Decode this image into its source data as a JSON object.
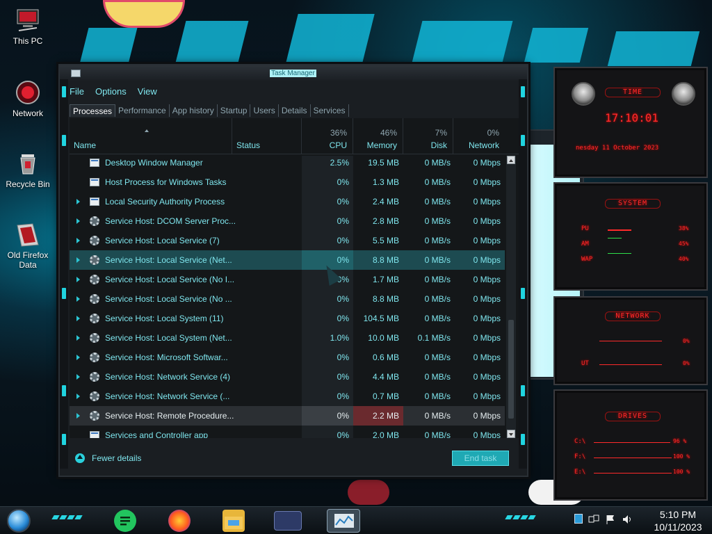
{
  "desktop": {
    "icons": [
      {
        "label": "This PC"
      },
      {
        "label": "Network"
      },
      {
        "label": "Recycle Bin"
      },
      {
        "label": "Old Firefox Data"
      }
    ]
  },
  "task_manager": {
    "title": "Task Manager",
    "menu": [
      "File",
      "Options",
      "View"
    ],
    "tabs": [
      "Processes",
      "Performance",
      "App history",
      "Startup",
      "Users",
      "Details",
      "Services"
    ],
    "active_tab": "Processes",
    "columns": {
      "name": {
        "label": "Name"
      },
      "status": {
        "label": "Status"
      },
      "cpu": {
        "label": "CPU",
        "pct": "36%"
      },
      "memory": {
        "label": "Memory",
        "pct": "46%"
      },
      "disk": {
        "label": "Disk",
        "pct": "7%"
      },
      "network": {
        "label": "Network",
        "pct": "0%"
      }
    },
    "processes": [
      {
        "name": "Desktop Window Manager",
        "cpu": "2.5%",
        "memory": "19.5 MB",
        "disk": "0 MB/s",
        "network": "0 Mbps",
        "icon": "window-icon",
        "expandable": false
      },
      {
        "name": "Host Process for Windows Tasks",
        "cpu": "0%",
        "memory": "1.3 MB",
        "disk": "0 MB/s",
        "network": "0 Mbps",
        "icon": "window-icon",
        "expandable": false
      },
      {
        "name": "Local Security Authority Process",
        "cpu": "0%",
        "memory": "2.4 MB",
        "disk": "0 MB/s",
        "network": "0 Mbps",
        "icon": "window-icon",
        "expandable": true
      },
      {
        "name": "Service Host: DCOM Server Proc...",
        "cpu": "0%",
        "memory": "2.8 MB",
        "disk": "0 MB/s",
        "network": "0 Mbps",
        "icon": "gear-icon",
        "expandable": true
      },
      {
        "name": "Service Host: Local Service (7)",
        "cpu": "0%",
        "memory": "5.5 MB",
        "disk": "0 MB/s",
        "network": "0 Mbps",
        "icon": "gear-icon",
        "expandable": true
      },
      {
        "name": "Service Host: Local Service (Net...",
        "cpu": "0%",
        "memory": "8.8 MB",
        "disk": "0 MB/s",
        "network": "0 Mbps",
        "icon": "gear-icon",
        "expandable": true,
        "state": "selected"
      },
      {
        "name": "Service Host: Local Service (No I...",
        "cpu": "0%",
        "memory": "1.7 MB",
        "disk": "0 MB/s",
        "network": "0 Mbps",
        "icon": "gear-icon",
        "expandable": true
      },
      {
        "name": "Service Host: Local Service (No ...",
        "cpu": "0%",
        "memory": "8.8 MB",
        "disk": "0 MB/s",
        "network": "0 Mbps",
        "icon": "gear-icon",
        "expandable": true
      },
      {
        "name": "Service Host: Local System (11)",
        "cpu": "0%",
        "memory": "104.5 MB",
        "disk": "0 MB/s",
        "network": "0 Mbps",
        "icon": "gear-icon",
        "expandable": true
      },
      {
        "name": "Service Host: Local System (Net...",
        "cpu": "1.0%",
        "memory": "10.0 MB",
        "disk": "0.1 MB/s",
        "network": "0 Mbps",
        "icon": "gear-icon",
        "expandable": true
      },
      {
        "name": "Service Host: Microsoft Softwar...",
        "cpu": "0%",
        "memory": "0.6 MB",
        "disk": "0 MB/s",
        "network": "0 Mbps",
        "icon": "gear-icon",
        "expandable": true
      },
      {
        "name": "Service Host: Network Service (4)",
        "cpu": "0%",
        "memory": "4.4 MB",
        "disk": "0 MB/s",
        "network": "0 Mbps",
        "icon": "gear-icon",
        "expandable": true
      },
      {
        "name": "Service Host: Network Service (...",
        "cpu": "0%",
        "memory": "0.7 MB",
        "disk": "0 MB/s",
        "network": "0 Mbps",
        "icon": "gear-icon",
        "expandable": true
      },
      {
        "name": "Service Host: Remote Procedure...",
        "cpu": "0%",
        "memory": "2.2 MB",
        "disk": "0 MB/s",
        "network": "0 Mbps",
        "icon": "gear-icon",
        "expandable": true,
        "state": "hover"
      },
      {
        "name": "Services and Controller app",
        "cpu": "0%",
        "memory": "2.0 MB",
        "disk": "0 MB/s",
        "network": "0 Mbps",
        "icon": "window-icon",
        "expandable": false
      }
    ],
    "footer": {
      "fewer_details": "Fewer details",
      "end_task": "End task"
    }
  },
  "gadgets": {
    "time": {
      "title": "TIME",
      "clock": "17:10:01",
      "date": "nesday 11 October 2023"
    },
    "system": {
      "title": "SYSTEM",
      "rows": [
        {
          "label": "PU",
          "value": "38%"
        },
        {
          "label": "AM",
          "value": "45%"
        },
        {
          "label": "WAP",
          "value": "40%"
        }
      ]
    },
    "network": {
      "title": "NETWORK",
      "rows": [
        {
          "label": "",
          "value": "0%"
        },
        {
          "label": "UT",
          "value": "0%"
        }
      ]
    },
    "drives": {
      "title": "DRIVES",
      "rows": [
        {
          "label": "C:\\",
          "value": "96 %"
        },
        {
          "label": "F:\\",
          "value": "100 %"
        },
        {
          "label": "E:\\",
          "value": "100 %"
        }
      ]
    }
  },
  "taskbar": {
    "clock_time": "5:10 PM",
    "clock_date": "10/11/2023"
  },
  "colors": {
    "accent": "#20d4e0",
    "gadget_red": "#ff2a2a"
  }
}
